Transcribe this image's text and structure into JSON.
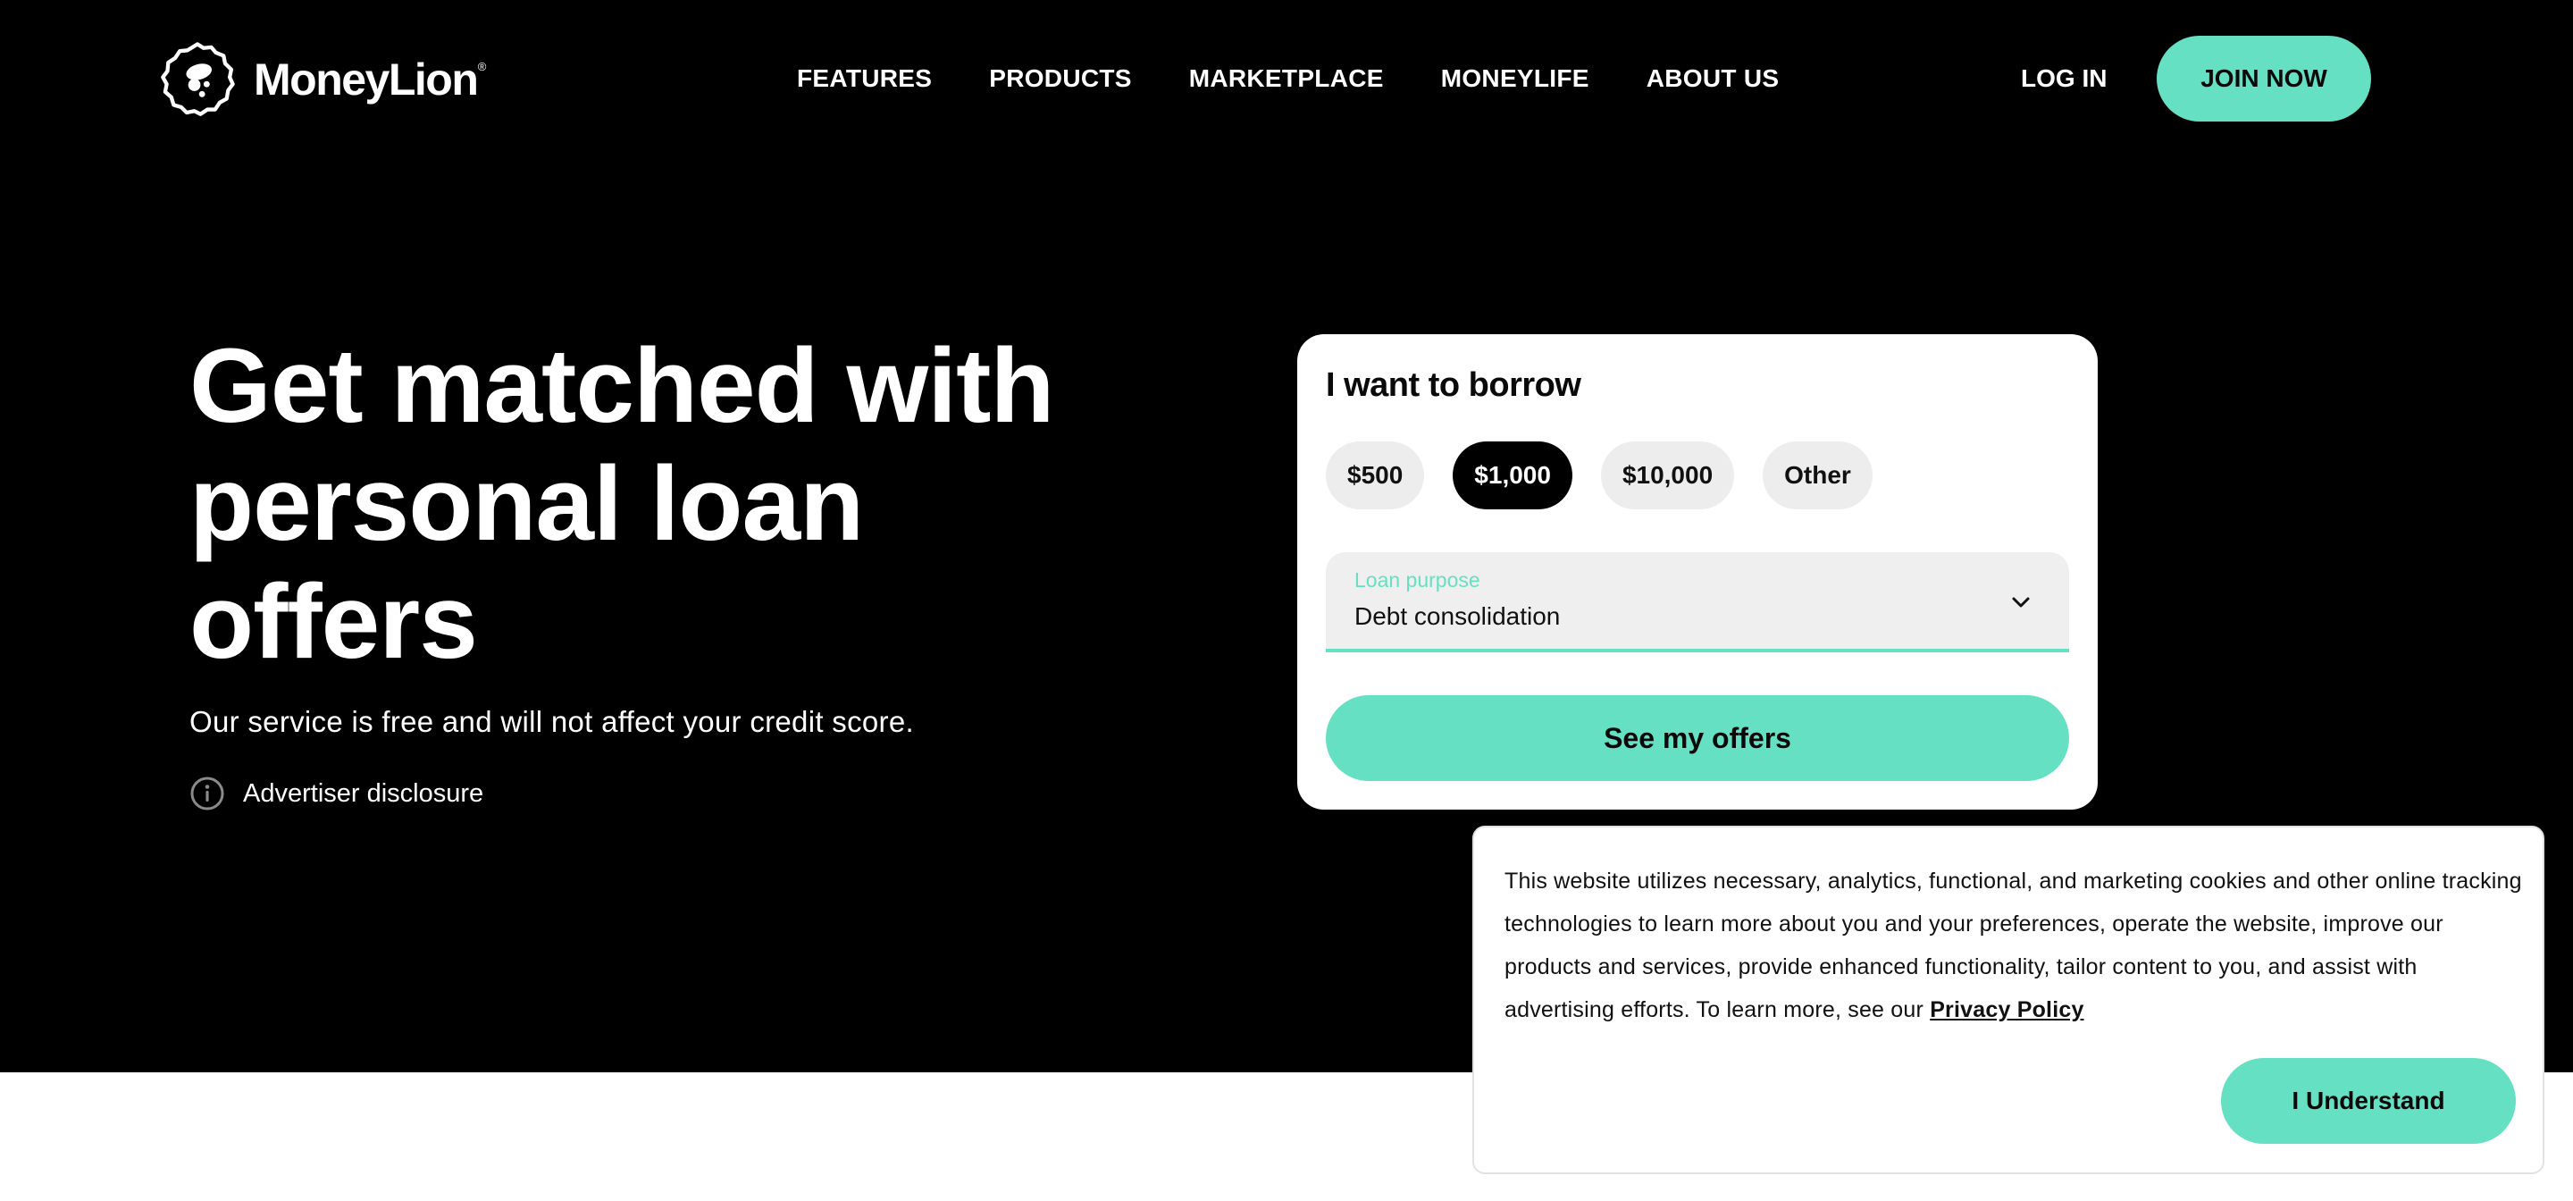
{
  "brand": {
    "name": "MoneyLion",
    "registered_mark": "®",
    "accent_color": "#66e0c2",
    "background_color": "#000000"
  },
  "header": {
    "nav": [
      "FEATURES",
      "PRODUCTS",
      "MARKETPLACE",
      "MONEYLIFE",
      "ABOUT US"
    ],
    "login_label": "LOG IN",
    "join_label": "JOIN NOW"
  },
  "hero": {
    "title": "Get matched with personal loan offers",
    "subtitle": "Our service is free and will not affect your credit score.",
    "disclosure_label": "Advertiser disclosure",
    "disclosure_icon": "info-icon"
  },
  "borrow_card": {
    "title": "I want to borrow",
    "amounts": [
      "$500",
      "$1,000",
      "$10,000",
      "Other"
    ],
    "selected_amount": "$1,000",
    "purpose": {
      "label": "Loan purpose",
      "value": "Debt consolidation",
      "icon": "chevron-down-icon"
    },
    "cta_label": "See my offers"
  },
  "cookie_banner": {
    "text": "This website utilizes necessary, analytics, functional, and marketing cookies and other online tracking technologies to learn more about you and your preferences, operate the website, improve our products and services, provide enhanced functionality, tailor content to you, and assist with advertising efforts. To learn more, see our",
    "link_label": "Privacy Policy",
    "accept_label": "I Understand"
  }
}
